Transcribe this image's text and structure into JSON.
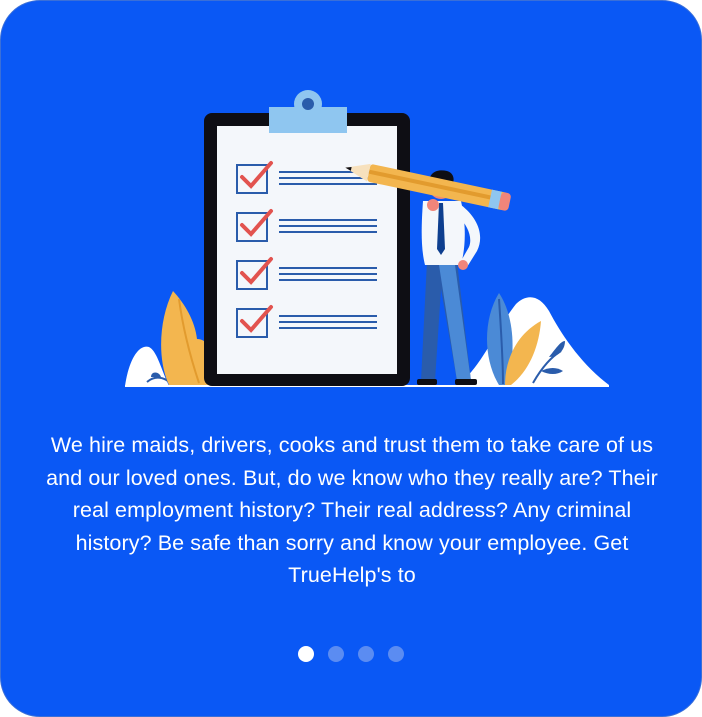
{
  "onboarding": {
    "illustration_icon": "checklist-with-person-and-pencil",
    "description": "We hire maids, drivers, cooks and trust them to take care of us and our loved ones. But, do we know who they really are? Their real employment history? Their real address? Any criminal history? Be safe than sorry and know your employee. Get TrueHelp's to",
    "pagination": {
      "total": 4,
      "active_index": 0
    }
  },
  "colors": {
    "background": "#0a58f5",
    "text": "#ffffff",
    "dot_active": "#ffffff",
    "dot_inactive": "#5b8cf2",
    "check": "#e2534f",
    "plant_yellow": "#f3b64f"
  }
}
